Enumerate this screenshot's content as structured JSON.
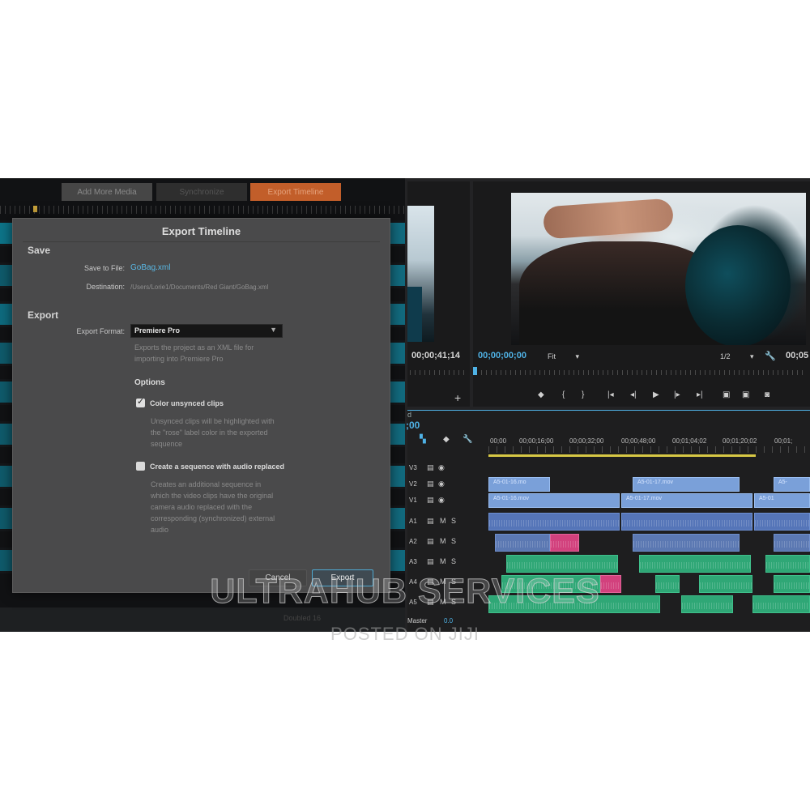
{
  "left_app": {
    "buttons": {
      "add_media": "Add More Media",
      "synchronize": "Synchronize",
      "export_timeline": "Export Timeline"
    },
    "bottom_label": "Doubled 16"
  },
  "dialog": {
    "title": "Export Timeline",
    "save_section": "Save",
    "save_to_file_label": "Save to File:",
    "save_to_file_value": "GoBag.xml",
    "destination_label": "Destination:",
    "destination_value": "/Users/Lorie1/Documents/Red Giant/GoBag.xml",
    "export_section": "Export",
    "export_format_label": "Export Format:",
    "export_format_value": "Premiere Pro",
    "format_desc_1": "Exports the project as an XML file for",
    "format_desc_2": "importing into Premiere Pro",
    "options_heading": "Options",
    "opt1_label": "Color unsynced clips",
    "opt1_checked": true,
    "opt1_desc_1": "Unsynced clips will be highlighted with",
    "opt1_desc_2": "the \"rose\" label color in the exported",
    "opt1_desc_3": "sequence",
    "opt2_label": "Create a sequence with audio replaced",
    "opt2_checked": false,
    "opt2_desc_1": "Creates an additional sequence in",
    "opt2_desc_2": "which the video clips have the original",
    "opt2_desc_3": "camera audio replaced with the",
    "opt2_desc_4": "corresponding (synchronized) external",
    "opt2_desc_5": "audio",
    "cancel_label": "Cancel",
    "export_label": "Export"
  },
  "premiere": {
    "source_timecode": "00;00;41;14",
    "program_timecode": "00;00;00;00",
    "program_timecode_right": "00;05",
    "fit_label": "Fit",
    "resolution_label": "1/2",
    "timeline_timecode": ";00",
    "timeline_timecode_top": "d",
    "ruler_labels": [
      "00;00",
      "00;00;16;00",
      "00;00;32;00",
      "00;00;48;00",
      "00;01;04;02",
      "00;01;20;02",
      "00;01;"
    ],
    "tracks": [
      "V3",
      "V2",
      "V1",
      "A1",
      "A2",
      "A3",
      "A4",
      "A5"
    ],
    "clips": {
      "v2_a": "A5-01-16.mo",
      "v2_b": "A5-01-17.mov",
      "v2_c": "A5-",
      "v1_a": "A5-01-16.mov",
      "v1_b": "A5-01-17.mov",
      "v1_c": "A5-01"
    },
    "master_label": "Master",
    "master_value": "0.0"
  },
  "watermark": {
    "main": "ULTRAHUB SERVICES",
    "sub": "POSTED ON JIJI"
  },
  "colors": {
    "accent_blue": "#4fb2e6",
    "orange": "#c25e2a",
    "video_clip": "#7aa0d9",
    "audio_green": "#2fa776",
    "unsynced_rose": "#d2417d"
  }
}
